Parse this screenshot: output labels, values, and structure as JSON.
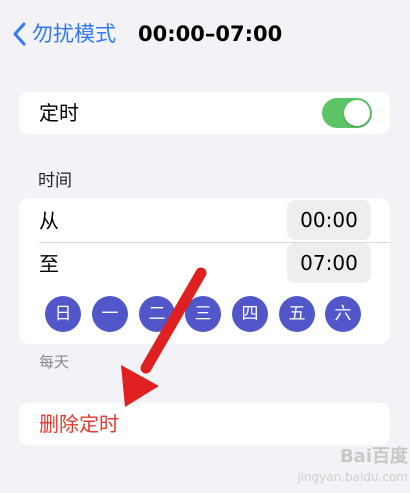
{
  "nav": {
    "back_label": "勿扰模式",
    "title": "00:00–07:00"
  },
  "timed": {
    "label": "定时",
    "enabled": true
  },
  "time_section": {
    "header": "时间",
    "from_label": "从",
    "from_value": "00:00",
    "to_label": "至",
    "to_value": "07:00",
    "days": [
      "日",
      "一",
      "二",
      "三",
      "四",
      "五",
      "六"
    ],
    "footer": "每天"
  },
  "delete": {
    "label": "删除定时"
  },
  "watermark": {
    "logo": "Bai百度",
    "sub": "jingyan.baidu.com"
  },
  "colors": {
    "accent_blue": "#3478f6",
    "toggle_green": "#5dc466",
    "day_circle": "#5157c9",
    "destructive_red": "#e23a2f",
    "annotation_arrow": "#e02020"
  }
}
